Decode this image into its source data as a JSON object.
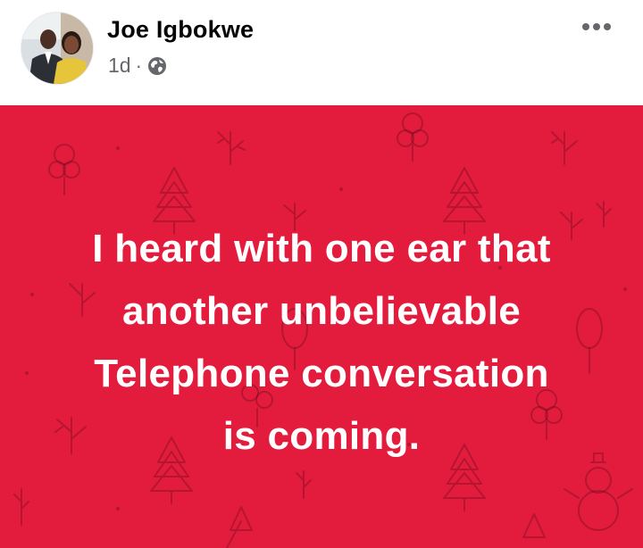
{
  "post": {
    "author": "Joe Igbokwe",
    "time": "1d",
    "separator": "·",
    "privacy_icon": "globe-icon",
    "more_icon": "more-options-icon",
    "background_color": "#e31c3d",
    "text_lines": [
      "I heard with one ear that",
      "another unbelievable",
      "Telephone conversation",
      "is coming."
    ]
  }
}
